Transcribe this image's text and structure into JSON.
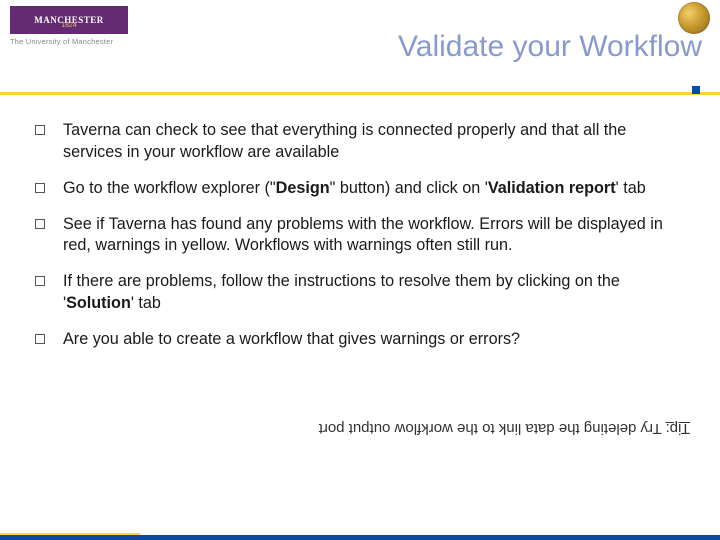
{
  "header": {
    "logo_text": "MANCHESTER",
    "logo_year": "1824",
    "logo_subtitle": "The University of Manchester"
  },
  "title": "Validate your Workflow",
  "bullets": [
    {
      "pre": "Taverna can check to see that everything is connected properly and that all the services in your workflow are available"
    },
    {
      "pre": "Go to the workflow explorer (\"",
      "bold1": "Design",
      "mid": "\" button) and click on '",
      "bold2": "Validation report",
      "post": "' tab"
    },
    {
      "pre": "See if Taverna has found any problems with the workflow. Errors will be displayed in red, warnings in yellow. Workflows with warnings often still run."
    },
    {
      "pre": "If there are problems, follow the instructions to resolve them by clicking on the '",
      "bold1": "Solution",
      "post": "' tab"
    },
    {
      "pre": "Are you able to create a workflow that gives warnings or errors?"
    }
  ],
  "tip": {
    "label": "Tip:",
    "text": " Try deleting the data link to the workflow output port"
  }
}
